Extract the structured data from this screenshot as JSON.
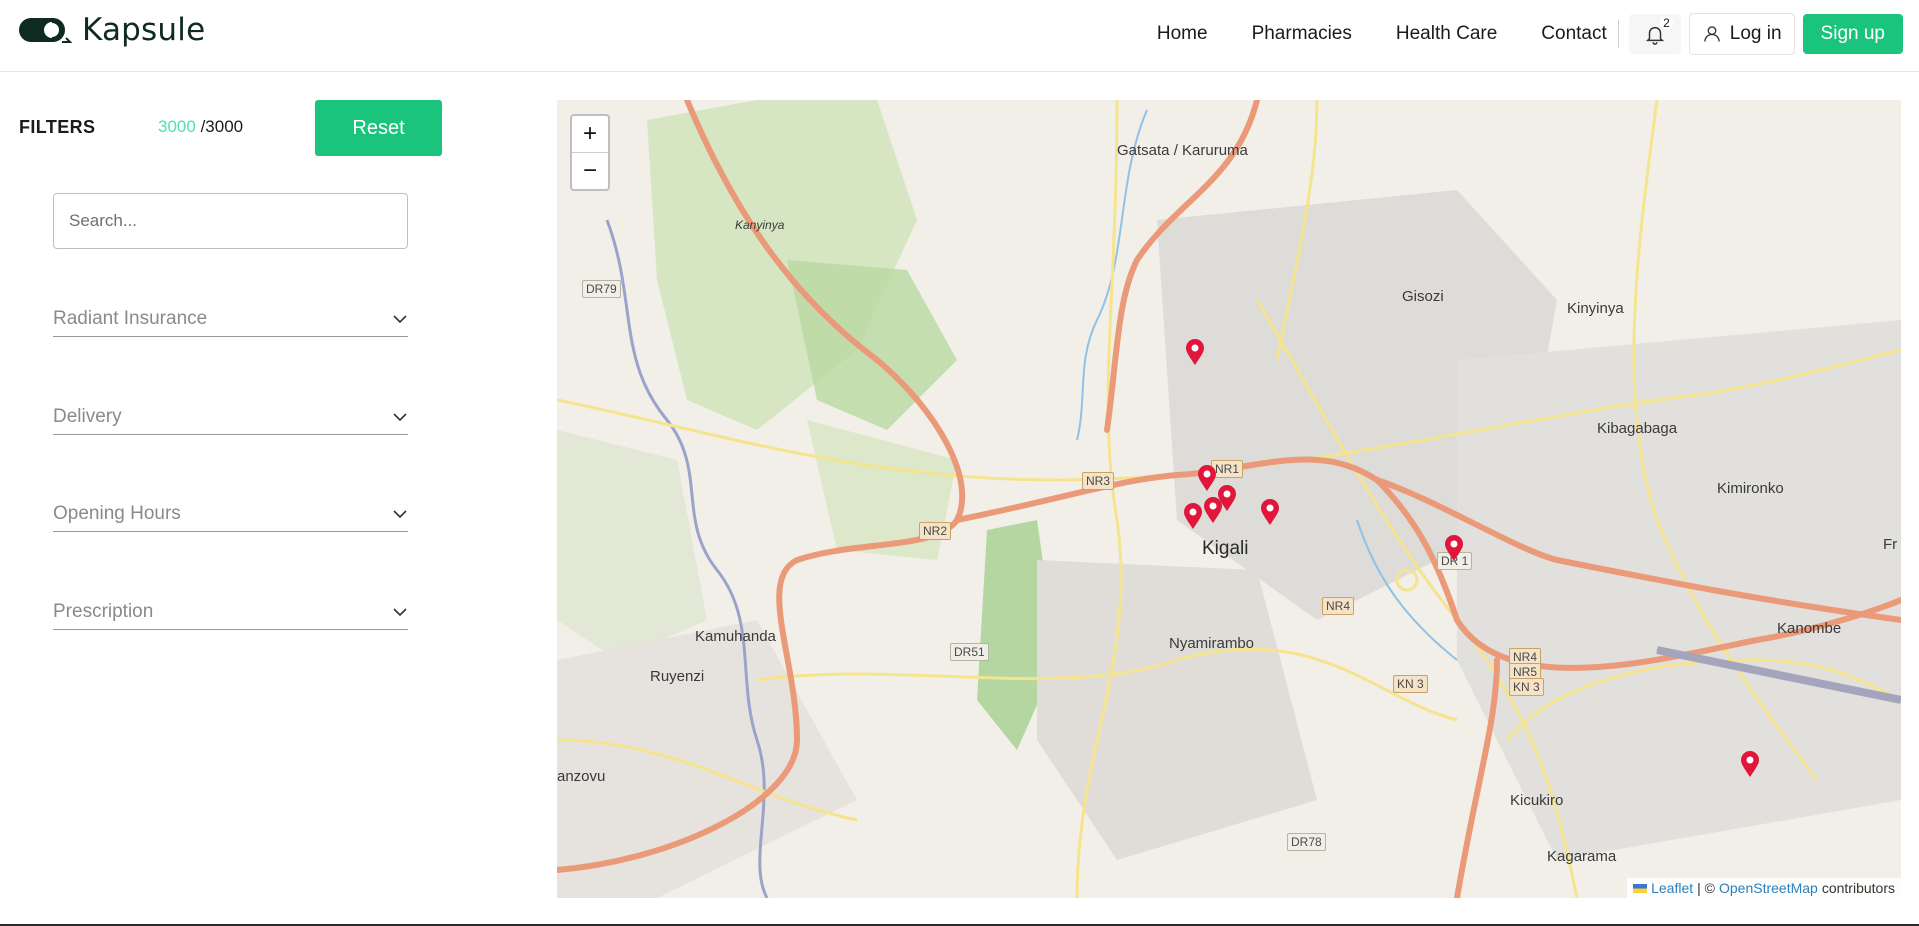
{
  "brand": {
    "name": "Kapsule",
    "accent": "#1bc47d"
  },
  "nav": {
    "links": [
      "Home",
      "Pharmacies",
      "Health Care",
      "Contact"
    ],
    "notification_count": "2",
    "login_label": "Log in",
    "signup_label": "Sign up"
  },
  "filters": {
    "title": "FILTERS",
    "count_shown": "3000",
    "count_total": "/3000",
    "reset_label": "Reset",
    "search_placeholder": "Search...",
    "dropdowns": [
      "Radiant Insurance",
      "Delivery",
      "Opening Hours",
      "Prescription"
    ]
  },
  "map": {
    "zoom_in": "+",
    "zoom_out": "−",
    "attribution": {
      "leaflet": "Leaflet",
      "separator": "| ©",
      "osm": "OpenStreetMap",
      "suffix": "contributors"
    },
    "labels": {
      "gatsata": "Gatsata / Karuruma",
      "gisozi": "Gisozi",
      "kinyinya": "Kinyinya",
      "kibagabaga": "Kibagabaga",
      "kimironko": "Kimironko",
      "kigali": "Kigali",
      "nyamirambo": "Nyamirambo",
      "kamuhanda": "Kamuhanda",
      "ruyenzi": "Ruyenzi",
      "kanombe": "Kanombe",
      "kicukiro": "Kicukiro",
      "kagarama": "Kagarama",
      "kanyinya": "Kanyinya",
      "nzovu": "anzovu",
      "fr": "Fr"
    },
    "shields": {
      "dr79": "DR79",
      "nr3": "NR3",
      "nr2": "NR2",
      "dr51": "DR51",
      "nr1": "NR1",
      "nr4": "NR4",
      "kn3": "KN 3",
      "nr4b": "NR4",
      "nr5": "NR5",
      "kn3b": "KN 3",
      "dr78": "DR78",
      "dr1": "DR 1"
    },
    "pin_color": "#e0163b"
  }
}
